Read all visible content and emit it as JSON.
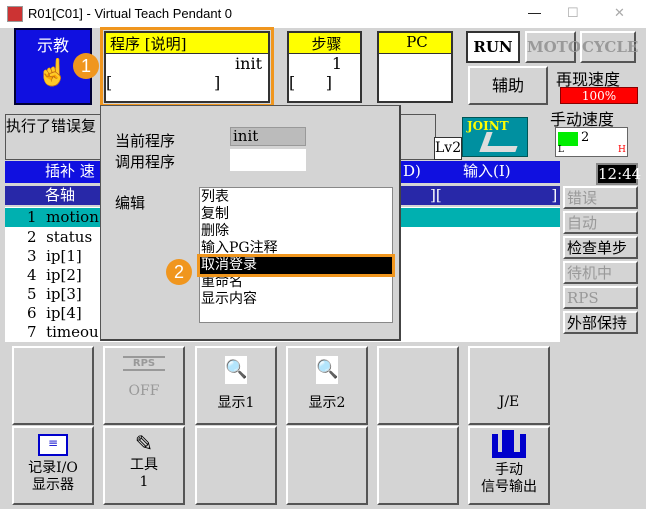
{
  "window": {
    "title": "R01[C01] - Virtual Teach Pendant 0",
    "minimize": "—",
    "maximize": "☐",
    "close": "✕"
  },
  "teach": {
    "label": "示教",
    "icon": "hand-pointer-icon"
  },
  "program": {
    "header": "程序  [说明]",
    "value": "init",
    "comment": "[                    ]"
  },
  "step": {
    "header": "步骤",
    "value": "1",
    "comment": "[      ]"
  },
  "pc": {
    "header": "PC"
  },
  "mode": {
    "run": "RUN",
    "motor": "MOTOR",
    "cycle": "CYCLE"
  },
  "aux": "辅助",
  "replay_speed": {
    "label": "再现速度",
    "value": "100%"
  },
  "manual_speed": {
    "label": "手动速度",
    "value": "2",
    "high": "H",
    "low": "L"
  },
  "message": "执行了错误复",
  "level": "Lv2",
  "joint": "JOINT",
  "clock": "12:44",
  "bar1": {
    "left": "插补  速",
    "right_a": "D)",
    "right_b": "输入(I)"
  },
  "bar2": {
    "left": "各轴",
    "right": "][                       ]"
  },
  "rows": [
    {
      "n": "1",
      "t": "motion"
    },
    {
      "n": "2",
      "t": "status"
    },
    {
      "n": "3",
      "t": "ip[1]"
    },
    {
      "n": "4",
      "t": "ip[2]"
    },
    {
      "n": "5",
      "t": "ip[3]"
    },
    {
      "n": "6",
      "t": "ip[4]"
    },
    {
      "n": "7",
      "t": "timeou"
    }
  ],
  "side": [
    "错误",
    "自动",
    "检查单步",
    "待机中",
    "RPS OFF",
    "外部保持"
  ],
  "popup": {
    "current_label": "当前程序",
    "current_value": "init",
    "call_label": "调用程序",
    "call_value": "",
    "edit_label": "编辑",
    "items": [
      "列表",
      "复制",
      "删除",
      "输入PG注释",
      "取消登录",
      "重命名",
      "显示内容"
    ],
    "selected": "取消登录"
  },
  "badges": [
    "1",
    "2"
  ],
  "fkeys": {
    "rps": "RPS",
    "off": "OFF",
    "disp1": "显示1",
    "disp2": "显示2",
    "je": "J/E",
    "io_a": "记录I/O",
    "io_b": "显示器",
    "tool_a": "工具",
    "tool_b": "1",
    "sig_a": "手动",
    "sig_b": "信号输出"
  },
  "colors": {
    "accent": "#f0961e",
    "blue": "#1010e0",
    "teal": "#00b0b0",
    "yellow": "#ffff00",
    "red": "#ff0000"
  }
}
